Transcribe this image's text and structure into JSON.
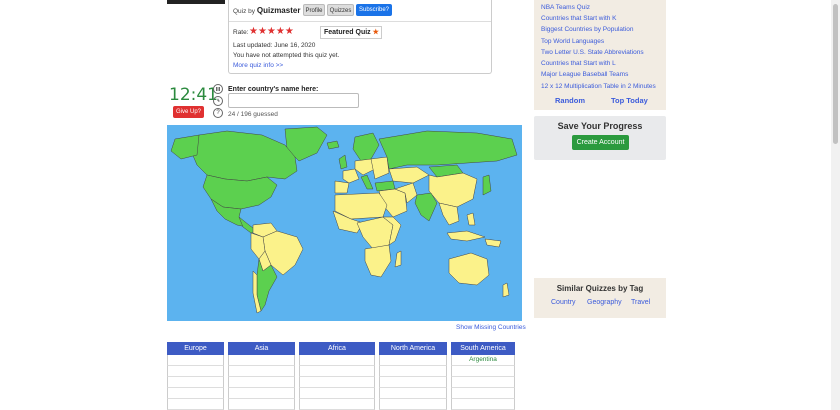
{
  "quiz_info": {
    "quiz_by_label": "Quiz by",
    "author": "Quizmaster",
    "buttons": {
      "profile": "Profile",
      "quizzes": "Quizzes",
      "subscribe": "Subscribe?"
    },
    "rate_label": "Rate:",
    "stars": "★★★★★",
    "featured_label": "Featured Quiz",
    "featured_icon": "★",
    "last_updated": "Last updated: June 16, 2020",
    "attempt_status": "You have not attempted this quiz yet.",
    "more_info": "More quiz info >>"
  },
  "game": {
    "timer": "12:41",
    "give_up": "Give Up?",
    "input_label": "Enter country's name here:",
    "input_value": "",
    "guessed": "24 / 196 guessed",
    "pause_icon": "pause-icon",
    "clock_icon": "clock-icon",
    "help_icon": "?",
    "show_missing": "Show Missing Countries"
  },
  "colors": {
    "ocean": "#5cb3ef",
    "guessed_country": "#5cd04f",
    "unguessed_country": "#fbf28a",
    "border": "#444444"
  },
  "answers": {
    "columns": [
      {
        "header": "Europe",
        "cells": [
          "",
          "",
          "",
          "",
          "",
          ""
        ]
      },
      {
        "header": "Asia",
        "cells": [
          "",
          "",
          "",
          "",
          "",
          ""
        ]
      },
      {
        "header": "Africa",
        "cells": [
          "",
          "",
          "",
          "",
          "",
          ""
        ]
      },
      {
        "header": "North America",
        "cells": [
          "",
          "",
          "",
          "",
          "",
          ""
        ]
      },
      {
        "header": "South America",
        "cells": [
          "Argentina",
          "",
          "",
          "",
          "",
          ""
        ]
      }
    ]
  },
  "sidebar": {
    "links": [
      "NBA Teams Quiz",
      "Countries that Start with K",
      "Biggest Countries by Population",
      "Top World Languages",
      "Two Letter U.S. State Abbreviations",
      "Countries that Start with L",
      "Major League Baseball Teams",
      "12 x 12 Multiplication Table in 2 Minutes"
    ],
    "random": "Random",
    "top_today": "Top Today",
    "save_title": "Save Your Progress",
    "create_account": "Create Account",
    "similar_title": "Similar Quizzes by Tag",
    "tags": [
      "Country",
      "Geography",
      "Travel"
    ]
  }
}
